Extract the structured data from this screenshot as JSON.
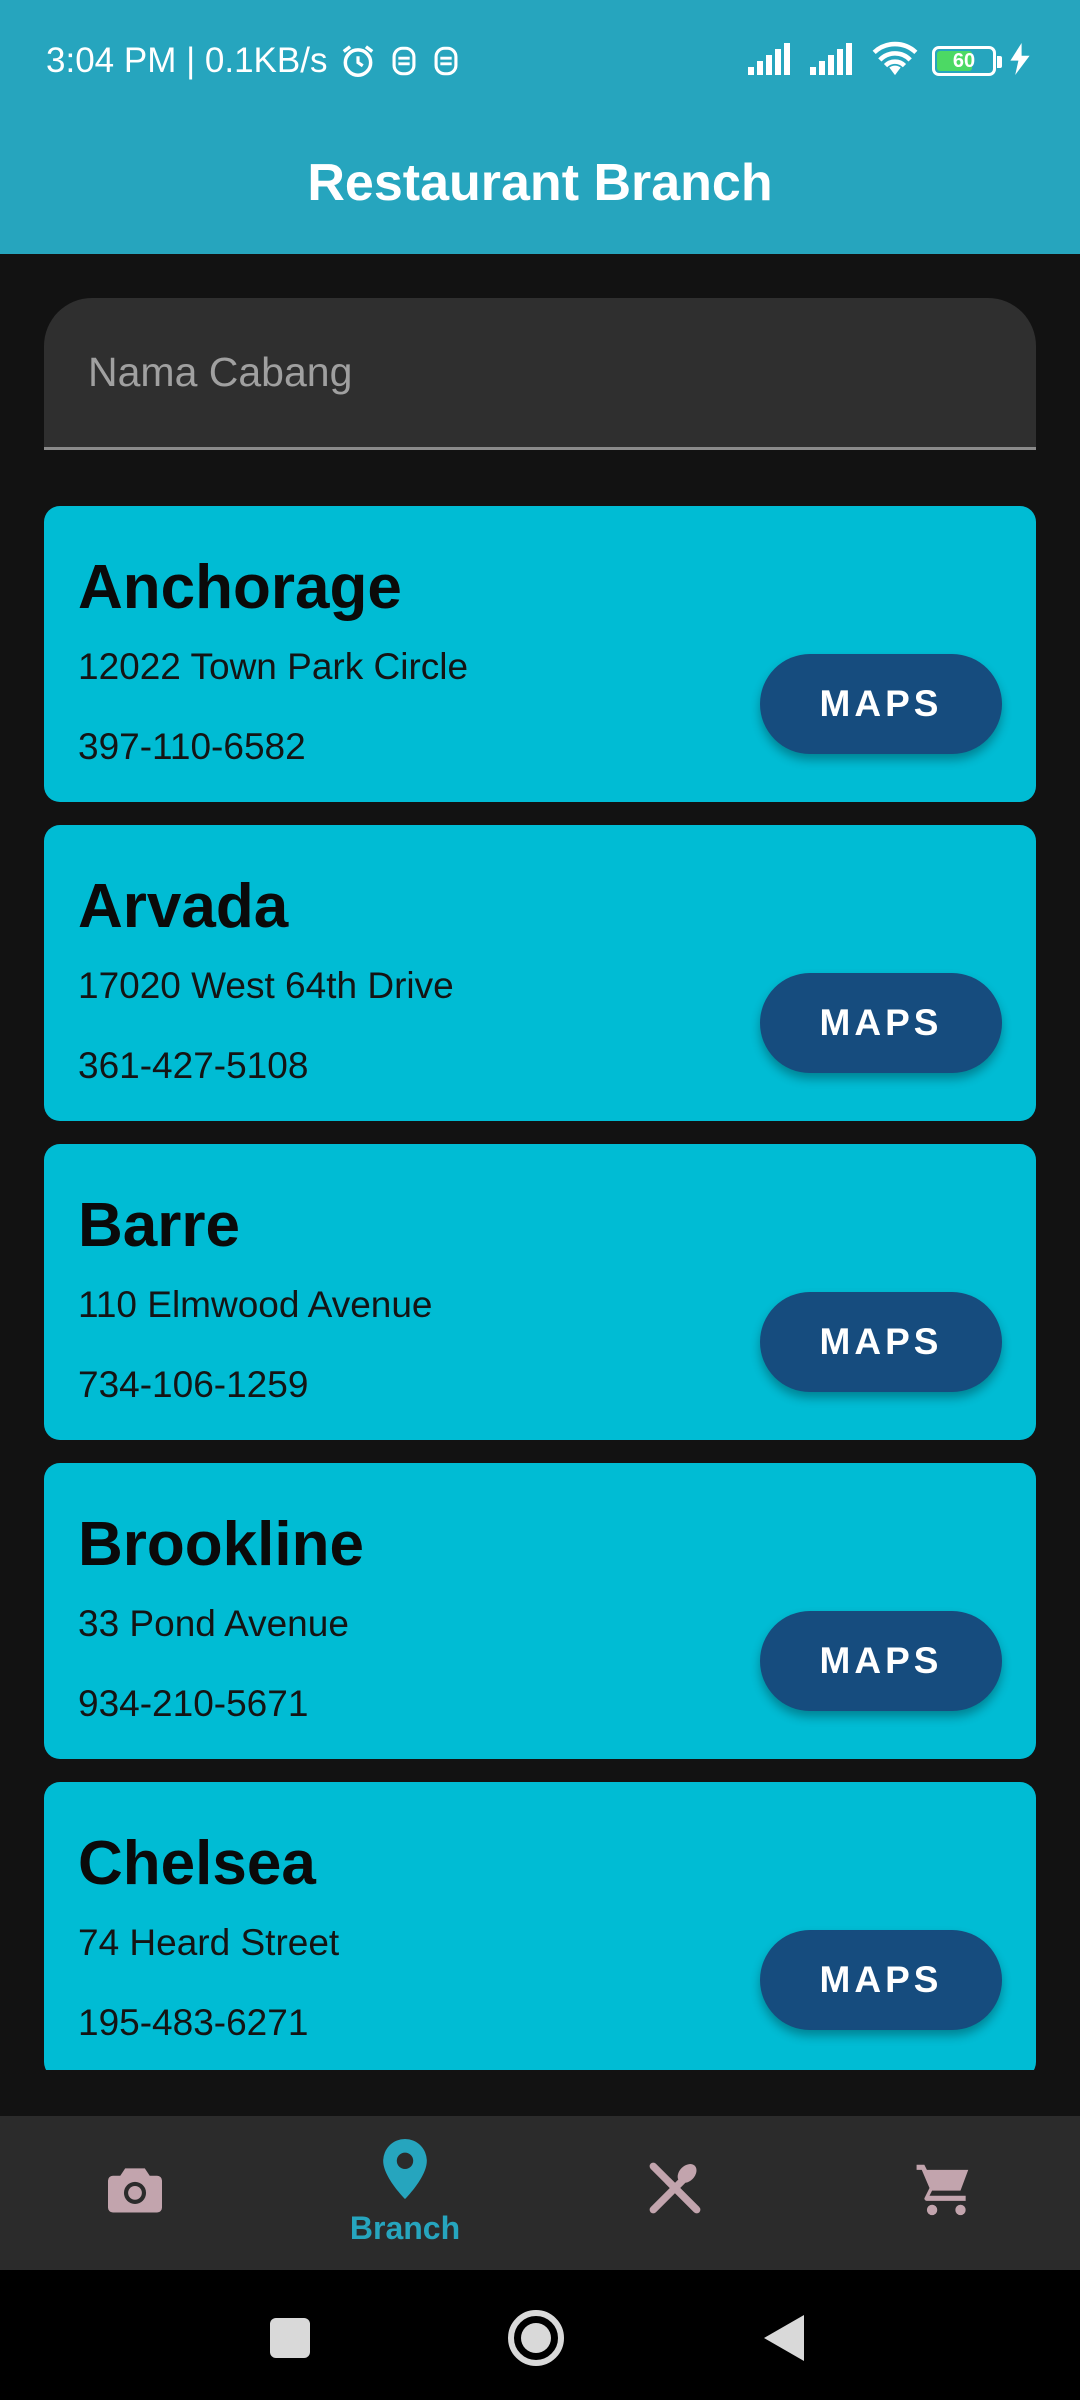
{
  "status_bar": {
    "time_speed": "3:04 PM | 0.1KB/s",
    "battery_level": "60",
    "icons": [
      "alarm-icon",
      "notification-icon",
      "notification-icon",
      "signal-icon",
      "signal-icon",
      "wifi-icon",
      "battery-icon",
      "charging-icon"
    ]
  },
  "app_bar": {
    "title": "Restaurant Branch"
  },
  "search": {
    "placeholder": "Nama Cabang",
    "value": ""
  },
  "branches": [
    {
      "name": "Anchorage",
      "address": "12022 Town Park Circle",
      "phone": "397-110-6582",
      "button_label": "MAPS"
    },
    {
      "name": "Arvada",
      "address": "17020 West 64th Drive",
      "phone": "361-427-5108",
      "button_label": "MAPS"
    },
    {
      "name": "Barre",
      "address": "110 Elmwood Avenue",
      "phone": "734-106-1259",
      "button_label": "MAPS"
    },
    {
      "name": "Brookline",
      "address": "33 Pond Avenue",
      "phone": "934-210-5671",
      "button_label": "MAPS"
    },
    {
      "name": "Chelsea",
      "address": "74 Heard Street",
      "phone": "195-483-6271",
      "button_label": "MAPS"
    }
  ],
  "bottom_nav": {
    "items": [
      {
        "icon": "camera-icon",
        "label": "",
        "active": false
      },
      {
        "icon": "location-pin-icon",
        "label": "Branch",
        "active": true
      },
      {
        "icon": "utensils-icon",
        "label": "",
        "active": false
      },
      {
        "icon": "cart-icon",
        "label": "",
        "active": false
      }
    ]
  },
  "colors": {
    "app_bar": "#26a5be",
    "card": "#00bcd4",
    "button": "#164c7e",
    "background": "#121212",
    "nav_active": "#26a5be",
    "nav_inactive": "#c2a4ad"
  }
}
